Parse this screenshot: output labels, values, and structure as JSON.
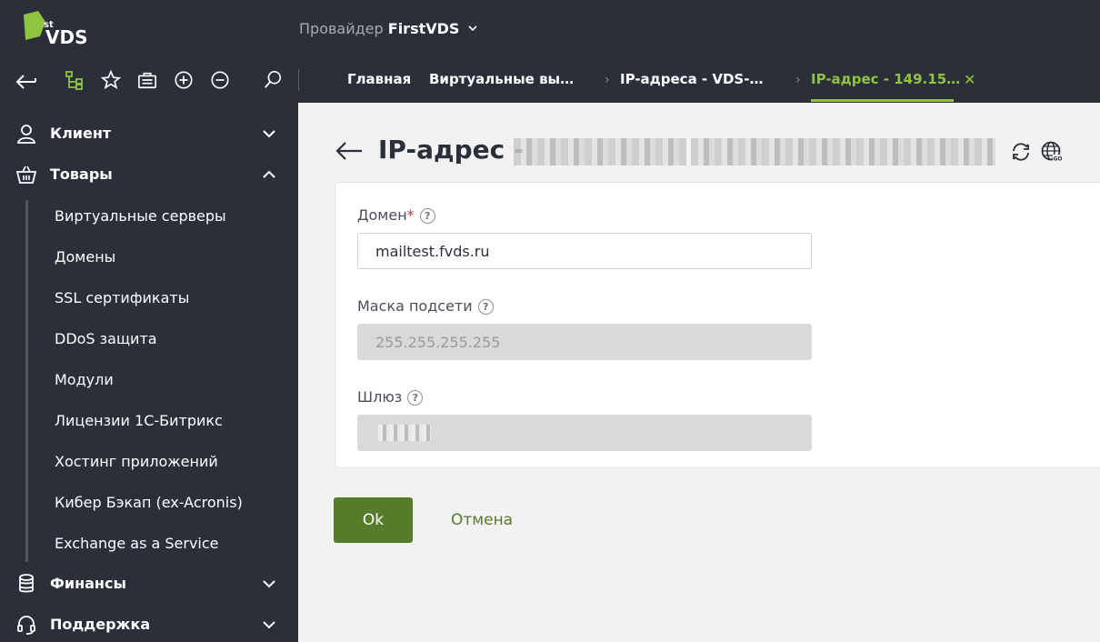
{
  "header": {
    "logo": {
      "sup": "st",
      "text": "VDS"
    },
    "provider_prefix": "Провайдер",
    "provider_name": "FirstVDS"
  },
  "toolbar": {
    "icons": [
      "back-icon",
      "tree-icon",
      "star-icon",
      "briefcase-icon",
      "plus-circle-icon",
      "minus-circle-icon",
      "search-icon"
    ]
  },
  "tabs": [
    {
      "label": "Главная"
    },
    {
      "label": "Виртуальные вы…"
    },
    {
      "label": "IP-адреса - VDS-…"
    },
    {
      "label": "IP-адрес - 149.15…",
      "active": true
    }
  ],
  "sidebar": {
    "sections": [
      {
        "label": "Клиент",
        "icon": "user-icon",
        "expanded": false
      },
      {
        "label": "Товары",
        "icon": "basket-icon",
        "expanded": true
      },
      {
        "label": "Финансы",
        "icon": "coins-icon",
        "expanded": false
      },
      {
        "label": "Поддержка",
        "icon": "headset-icon",
        "expanded": false
      }
    ],
    "products": [
      "Виртуальные серверы",
      "Домены",
      "SSL сертификаты",
      "DDoS защита",
      "Модули",
      "Лицензии 1С-Битрикс",
      "Хостинг приложений",
      "Кибер Бэкап (ex-Acronis)",
      "Exchange as a Service"
    ]
  },
  "page": {
    "title": "IP-адрес -"
  },
  "form": {
    "domain": {
      "label": "Домен",
      "required_mark": "*",
      "value": "mailtest.fvds.ru"
    },
    "mask": {
      "label": "Маска подсети",
      "value": "255.255.255.255"
    },
    "gateway": {
      "label": "Шлюз"
    },
    "help_glyph": "?"
  },
  "actions": {
    "ok_label": "Ok",
    "cancel_label": "Отмена"
  },
  "colors": {
    "accent": "#8fc440",
    "button": "#547c2a",
    "sidebar_bg": "#2b2f3a"
  }
}
